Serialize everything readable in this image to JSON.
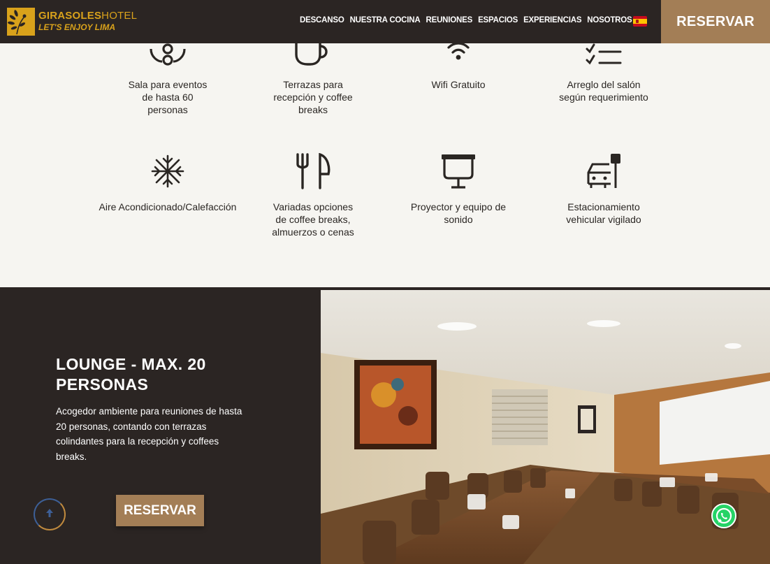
{
  "header": {
    "brand_bold": "GIRASOLES",
    "brand_light": "HOTEL",
    "tagline": "LET'S ENJOY LIMA",
    "nav": [
      "DESCANSO",
      "NUESTRA COCINA",
      "REUNIONES",
      "ESPACIOS",
      "EXPERIENCIAS",
      "NOSOTROS"
    ],
    "reserve_label": "RESERVAR",
    "language_icon": "spain-flag-icon"
  },
  "amenities": [
    {
      "label": "Sala para eventos de hasta 60 personas",
      "icon": "people-icon"
    },
    {
      "label": "Terrazas para recepción y coffee breaks",
      "icon": "coffee-cup-icon"
    },
    {
      "label": "Wifi Gratuito",
      "icon": "wifi-icon"
    },
    {
      "label": "Arreglo del salón según requerimiento",
      "icon": "checklist-icon"
    },
    {
      "label": "Aire Acondicionado/Calefacción",
      "icon": "snowflake-icon"
    },
    {
      "label": "Variadas opciones de coffee breaks, almuerzos o cenas",
      "icon": "fork-knife-icon"
    },
    {
      "label": "Proyector y equipo de sonido",
      "icon": "projector-icon"
    },
    {
      "label": "Estacionamiento vehicular vigilado",
      "icon": "car-icon"
    }
  ],
  "lounge": {
    "title": "LOUNGE - MAX. 20 PERSONAS",
    "description": "Acogedor ambiente para reuniones de hasta 20 personas, contando con terrazas colindantes para la recepción y coffees breaks.",
    "reserve_label": "RESERVAR"
  },
  "colors": {
    "dark": "#2b2523",
    "accent": "#a37e56",
    "logo": "#d9a21b",
    "background": "#f6f5f1",
    "whatsapp": "#25d366"
  }
}
